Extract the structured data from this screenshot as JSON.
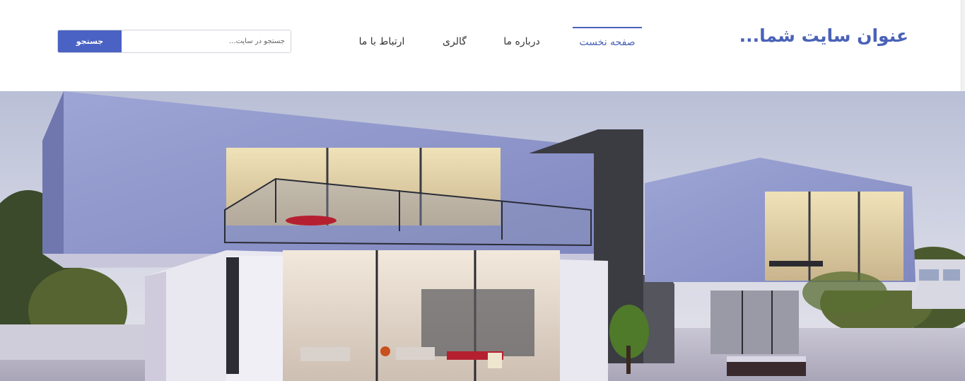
{
  "header": {
    "site_title": "عنوان سایت شما...",
    "nav": [
      {
        "label": "صفحه نخست",
        "active": true
      },
      {
        "label": "درباره ما",
        "active": false
      },
      {
        "label": "گالری",
        "active": false
      },
      {
        "label": "ارتباط با ما",
        "active": false
      }
    ],
    "search": {
      "placeholder": "جستجو در سایت...",
      "value": "",
      "button_label": "جستجو"
    }
  },
  "colors": {
    "accent": "#4a62b8",
    "button": "#4a62c4",
    "nav_text": "#333333"
  },
  "hero": {
    "image_subject": "modern-house-photo"
  }
}
